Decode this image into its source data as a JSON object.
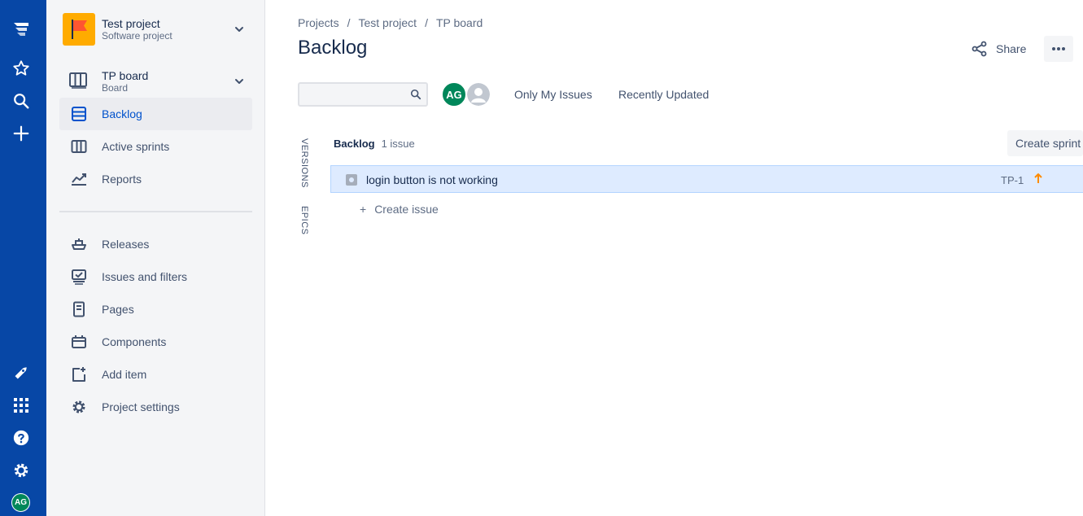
{
  "rail": {
    "avatar_initials": "AG",
    "icons": [
      "jira-logo-icon",
      "star-icon",
      "search-icon",
      "plus-icon",
      "notifications-icon",
      "app-switcher-icon",
      "help-icon",
      "settings-icon"
    ]
  },
  "sidebar": {
    "project_title": "Test project",
    "project_subtitle": "Software project",
    "board_title": "TP board",
    "board_subtitle": "Board",
    "items": [
      {
        "label": "Backlog",
        "active": true
      },
      {
        "label": "Active sprints"
      },
      {
        "label": "Reports"
      },
      {
        "label": "Releases"
      },
      {
        "label": "Issues and filters"
      },
      {
        "label": "Pages"
      },
      {
        "label": "Components"
      },
      {
        "label": "Add item"
      },
      {
        "label": "Project settings"
      }
    ]
  },
  "header": {
    "breadcrumbs": [
      "Projects",
      "Test project",
      "TP board"
    ],
    "title": "Backlog",
    "share_label": "Share"
  },
  "filters": {
    "search_placeholder": "",
    "avatar_initials": "AG",
    "only_my_issues": "Only My Issues",
    "recently_updated": "Recently Updated"
  },
  "side_tabs": {
    "versions": "VERSIONS",
    "epics": "EPICS"
  },
  "backlog": {
    "title": "Backlog",
    "count": "1 issue",
    "create_sprint": "Create sprint",
    "issues": [
      {
        "summary": "login button is not working",
        "key": "TP-1",
        "priority_color": "#ff8b00"
      }
    ],
    "create_issue": "Create issue"
  },
  "colors": {
    "rail": "#0747a6",
    "accent": "#0052cc",
    "selected_row": "#deebff",
    "avatar": "#00875a"
  }
}
